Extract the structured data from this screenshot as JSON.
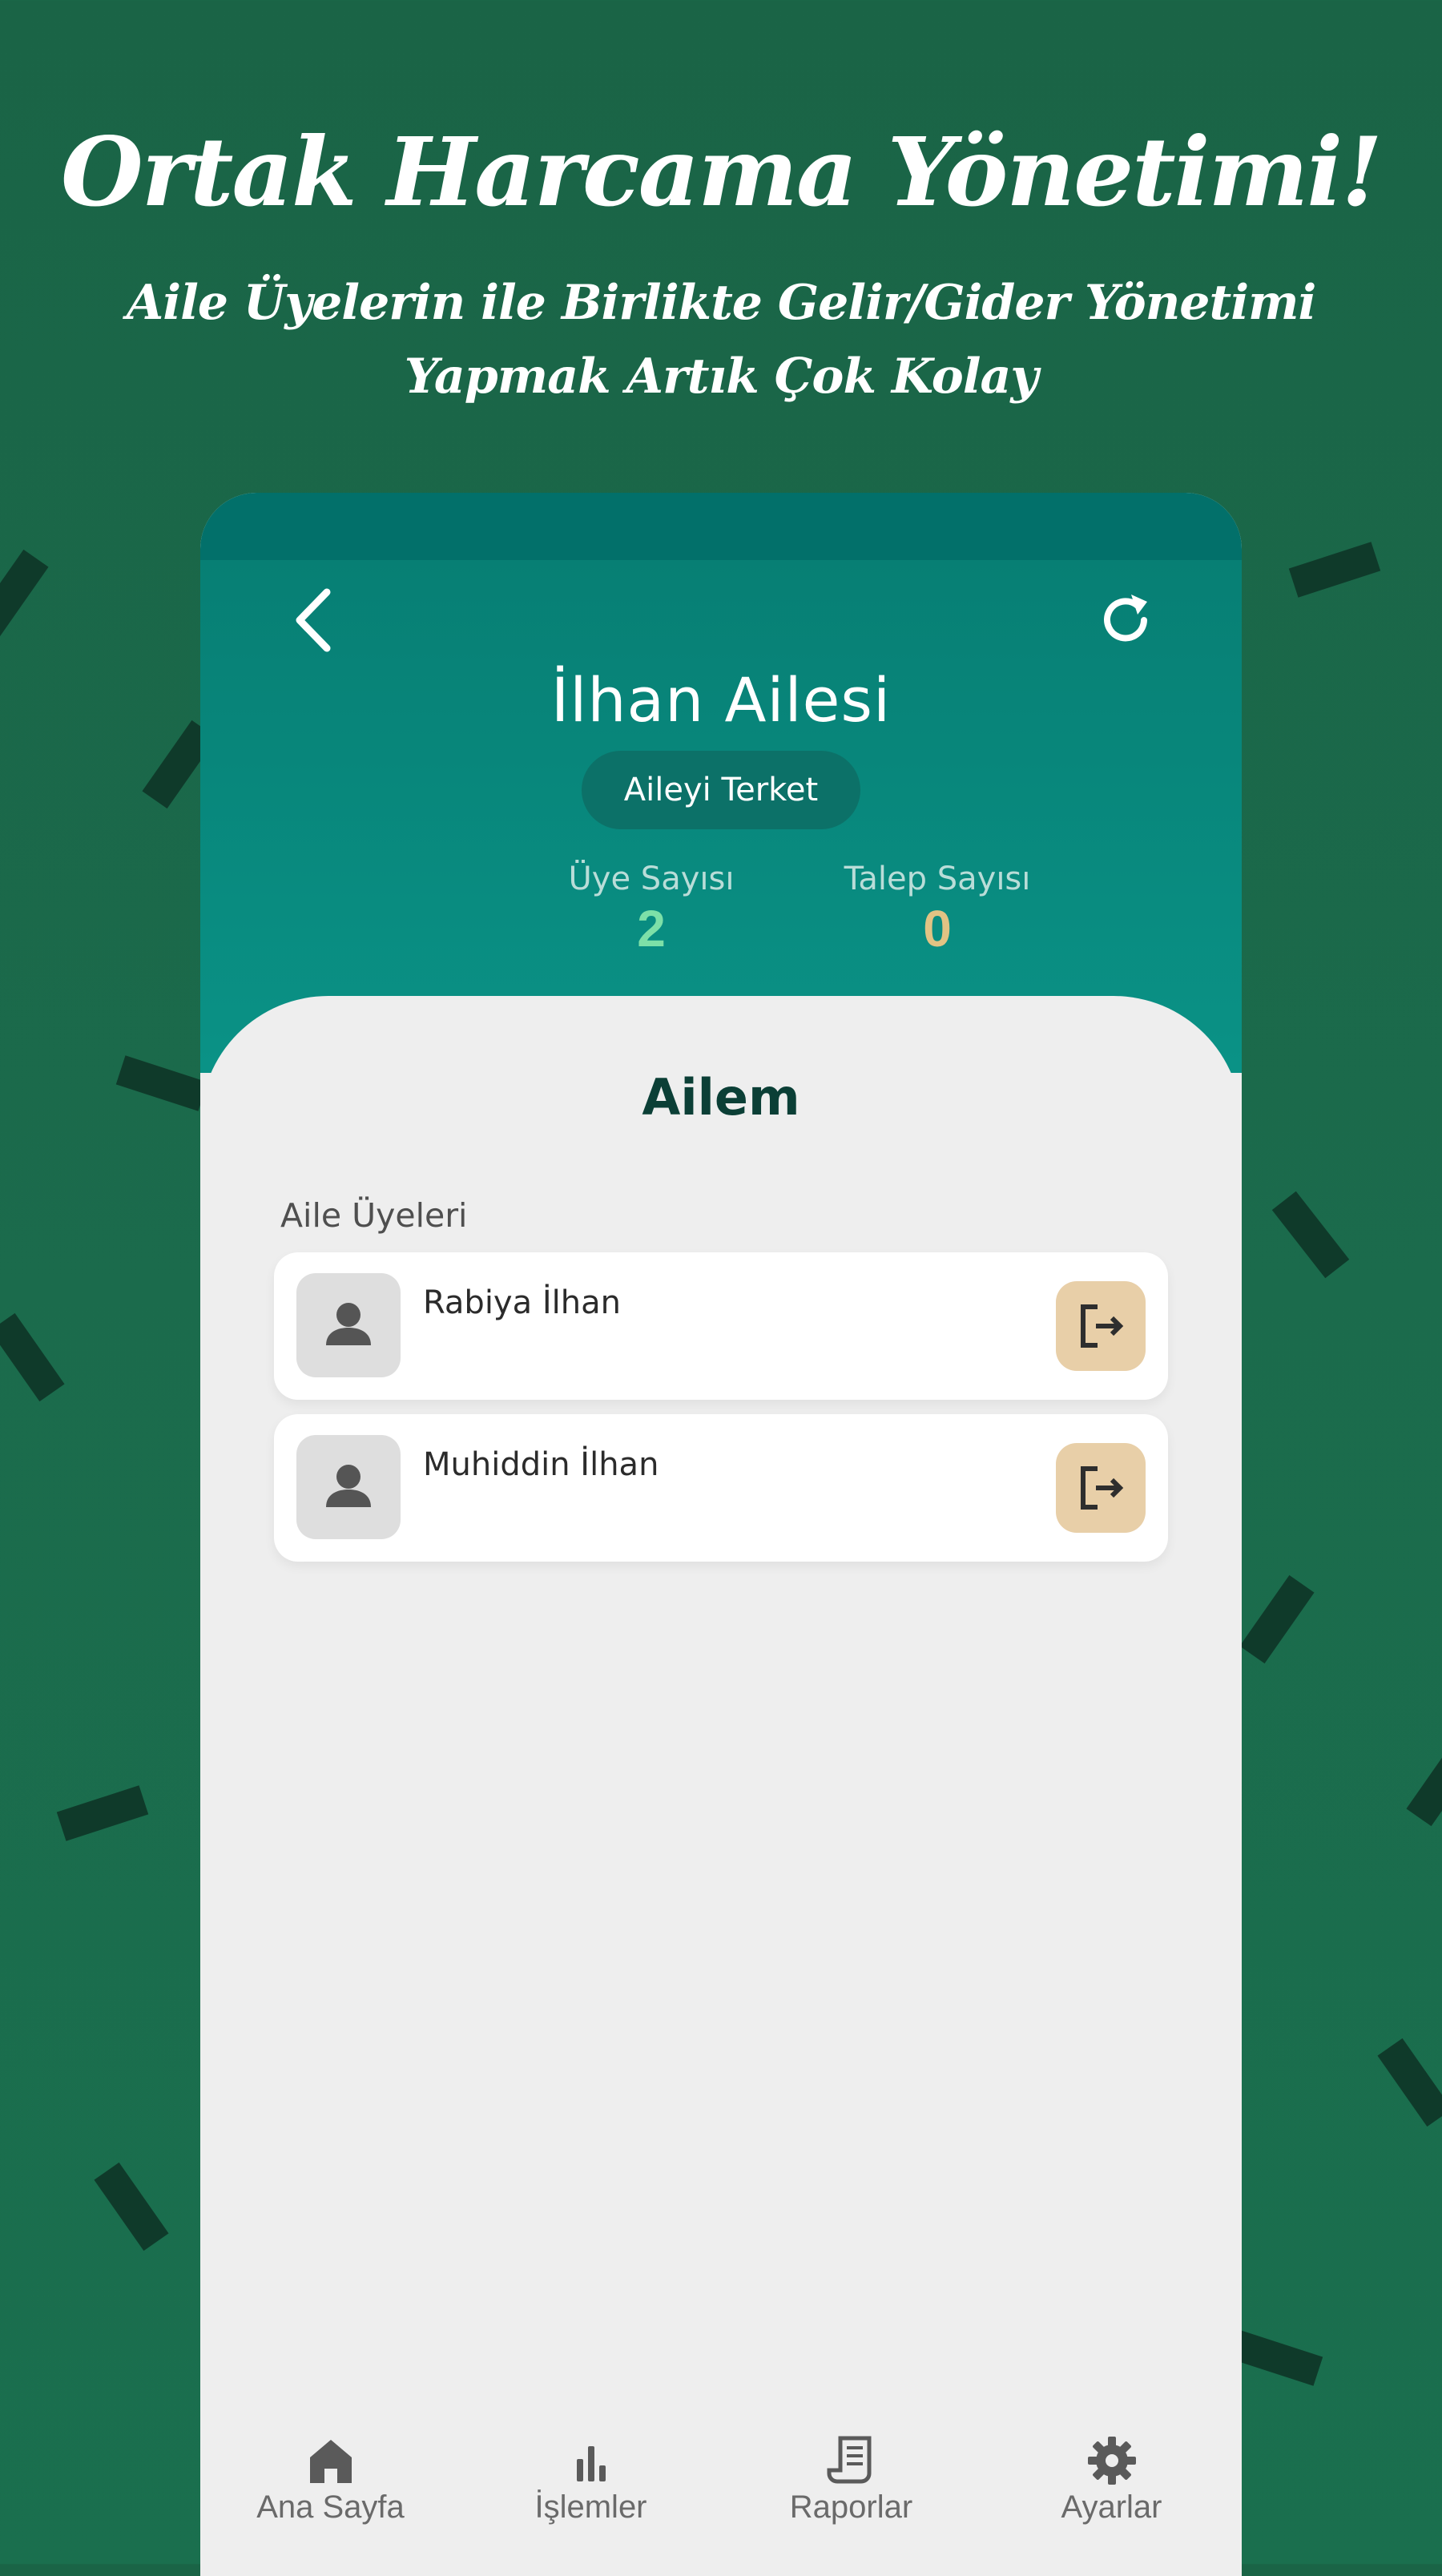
{
  "promo": {
    "title": "Ortak Harcama Yönetimi!",
    "subtitle_line1": "Aile Üyelerin ile Birlikte Gelir/Gider Yönetimi",
    "subtitle_line2": "Yapmak Artık Çok Kolay"
  },
  "header": {
    "back_icon": "chevron-left-icon",
    "refresh_icon": "refresh-icon",
    "family_name": "İlhan Ailesi",
    "leave_button": "Aileyi Terket"
  },
  "stats": {
    "members_label": "Üye Sayısı",
    "members_value": "2",
    "requests_label": "Talep Sayısı",
    "requests_value": "0"
  },
  "main": {
    "title": "Ailem",
    "members_section_label": "Aile Üyeleri",
    "members": [
      {
        "name": "Rabiya İlhan",
        "icon": "person-icon",
        "action_icon": "logout-icon"
      },
      {
        "name": "Muhiddin İlhan",
        "icon": "person-icon",
        "action_icon": "logout-icon"
      }
    ]
  },
  "nav": {
    "items": [
      {
        "label": "Ana Sayfa",
        "icon": "home-icon"
      },
      {
        "label": "İşlemler",
        "icon": "bar-chart-icon"
      },
      {
        "label": "Raporlar",
        "icon": "receipt-icon"
      },
      {
        "label": "Ayarlar",
        "icon": "gear-icon"
      }
    ]
  },
  "colors": {
    "background": "#1b6b4c",
    "header_teal": "#0a9286",
    "members_stat": "#7de0a8",
    "requests_stat": "#e1c384",
    "action_button": "#e8cfa8"
  }
}
